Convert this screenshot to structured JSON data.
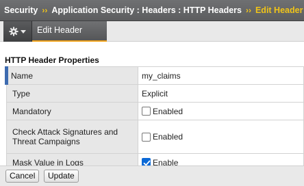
{
  "breadcrumb": {
    "items": [
      "Security",
      "Application Security : Headers : HTTP Headers",
      "Edit Header"
    ],
    "separator": "››"
  },
  "toolbar": {
    "gear_icon": "gear-icon",
    "tab_label": "Edit Header"
  },
  "section": {
    "title": "HTTP Header Properties"
  },
  "properties": [
    {
      "label": "Name",
      "value": "my_claims"
    },
    {
      "label": "Type",
      "value": "Explicit"
    },
    {
      "label": "Mandatory",
      "checkbox_label": "Enabled",
      "checked": false
    },
    {
      "label": "Check Attack Signatures and Threat Campaigns",
      "checkbox_label": "Enabled",
      "checked": false
    },
    {
      "label": "Mask Value in Logs",
      "checkbox_label": "Enable",
      "checked": true
    }
  ],
  "buttons": {
    "cancel": "Cancel",
    "update": "Update"
  },
  "colors": {
    "breadcrumb_highlight": "#f0c419",
    "checkbox_checked": "#0b69d6",
    "row_accent": "#3d6bb0"
  }
}
